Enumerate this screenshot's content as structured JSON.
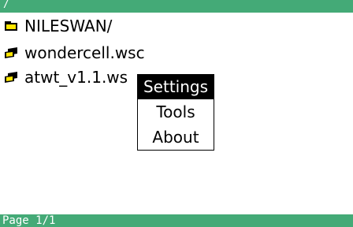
{
  "header": {
    "path": "/"
  },
  "files": [
    {
      "name": "NILESWAN/",
      "icon": "folder-icon"
    },
    {
      "name": "wondercell.wsc",
      "icon": "cartridge-icon"
    },
    {
      "name": "atwt_v1.1.ws",
      "icon": "cartridge-icon"
    }
  ],
  "menu": {
    "items": [
      {
        "label": "Settings",
        "selected": true
      },
      {
        "label": "Tools",
        "selected": false
      },
      {
        "label": "About",
        "selected": false
      }
    ]
  },
  "footer": {
    "page": "Page 1/1"
  },
  "colors": {
    "bar": "#44aa77",
    "folder": "#ffe600",
    "cartridge": "#ffe600",
    "selection": "#000000"
  }
}
